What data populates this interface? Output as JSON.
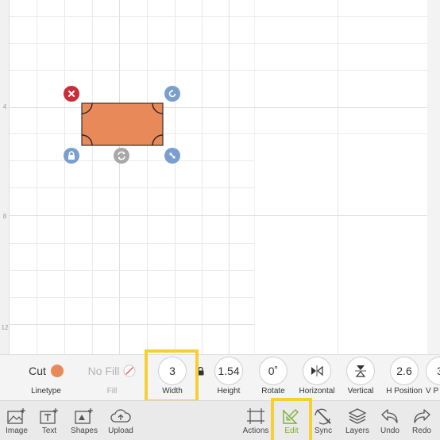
{
  "colors": {
    "shape_fill": "#e8895a",
    "delete_handle": "#cc2b3a",
    "blue_handle": "#7a9fcf",
    "gray_handle": "#a8a8a8",
    "highlight": "#f4d034",
    "active_tool": "#7cae2b"
  },
  "ruler": {
    "marks": [
      "4",
      "8",
      "12"
    ]
  },
  "properties": {
    "linetype": {
      "value": "Cut",
      "label": "Linetype",
      "color": "#e8895a"
    },
    "fill": {
      "value": "No Fill",
      "label": "Fill"
    },
    "width": {
      "value": "3",
      "label": "Width"
    },
    "height": {
      "value": "1.54",
      "label": "Height"
    },
    "rotate": {
      "value": "0˚",
      "label": "Rotate"
    },
    "horizontal": {
      "label": "Horizontal",
      "icon": "flip-horizontal-icon"
    },
    "vertical": {
      "label": "Vertical",
      "icon": "flip-vertical-icon"
    },
    "h_position": {
      "value": "2.6",
      "label": "H Position"
    },
    "v_position": {
      "value": "3",
      "label": "V P"
    }
  },
  "toolbar": {
    "image": "Image",
    "text": "Text",
    "shapes": "Shapes",
    "upload": "Upload",
    "actions": "Actions",
    "edit": "Edit",
    "sync": "Sync",
    "layers": "Layers",
    "undo": "Undo",
    "redo": "Redo"
  }
}
